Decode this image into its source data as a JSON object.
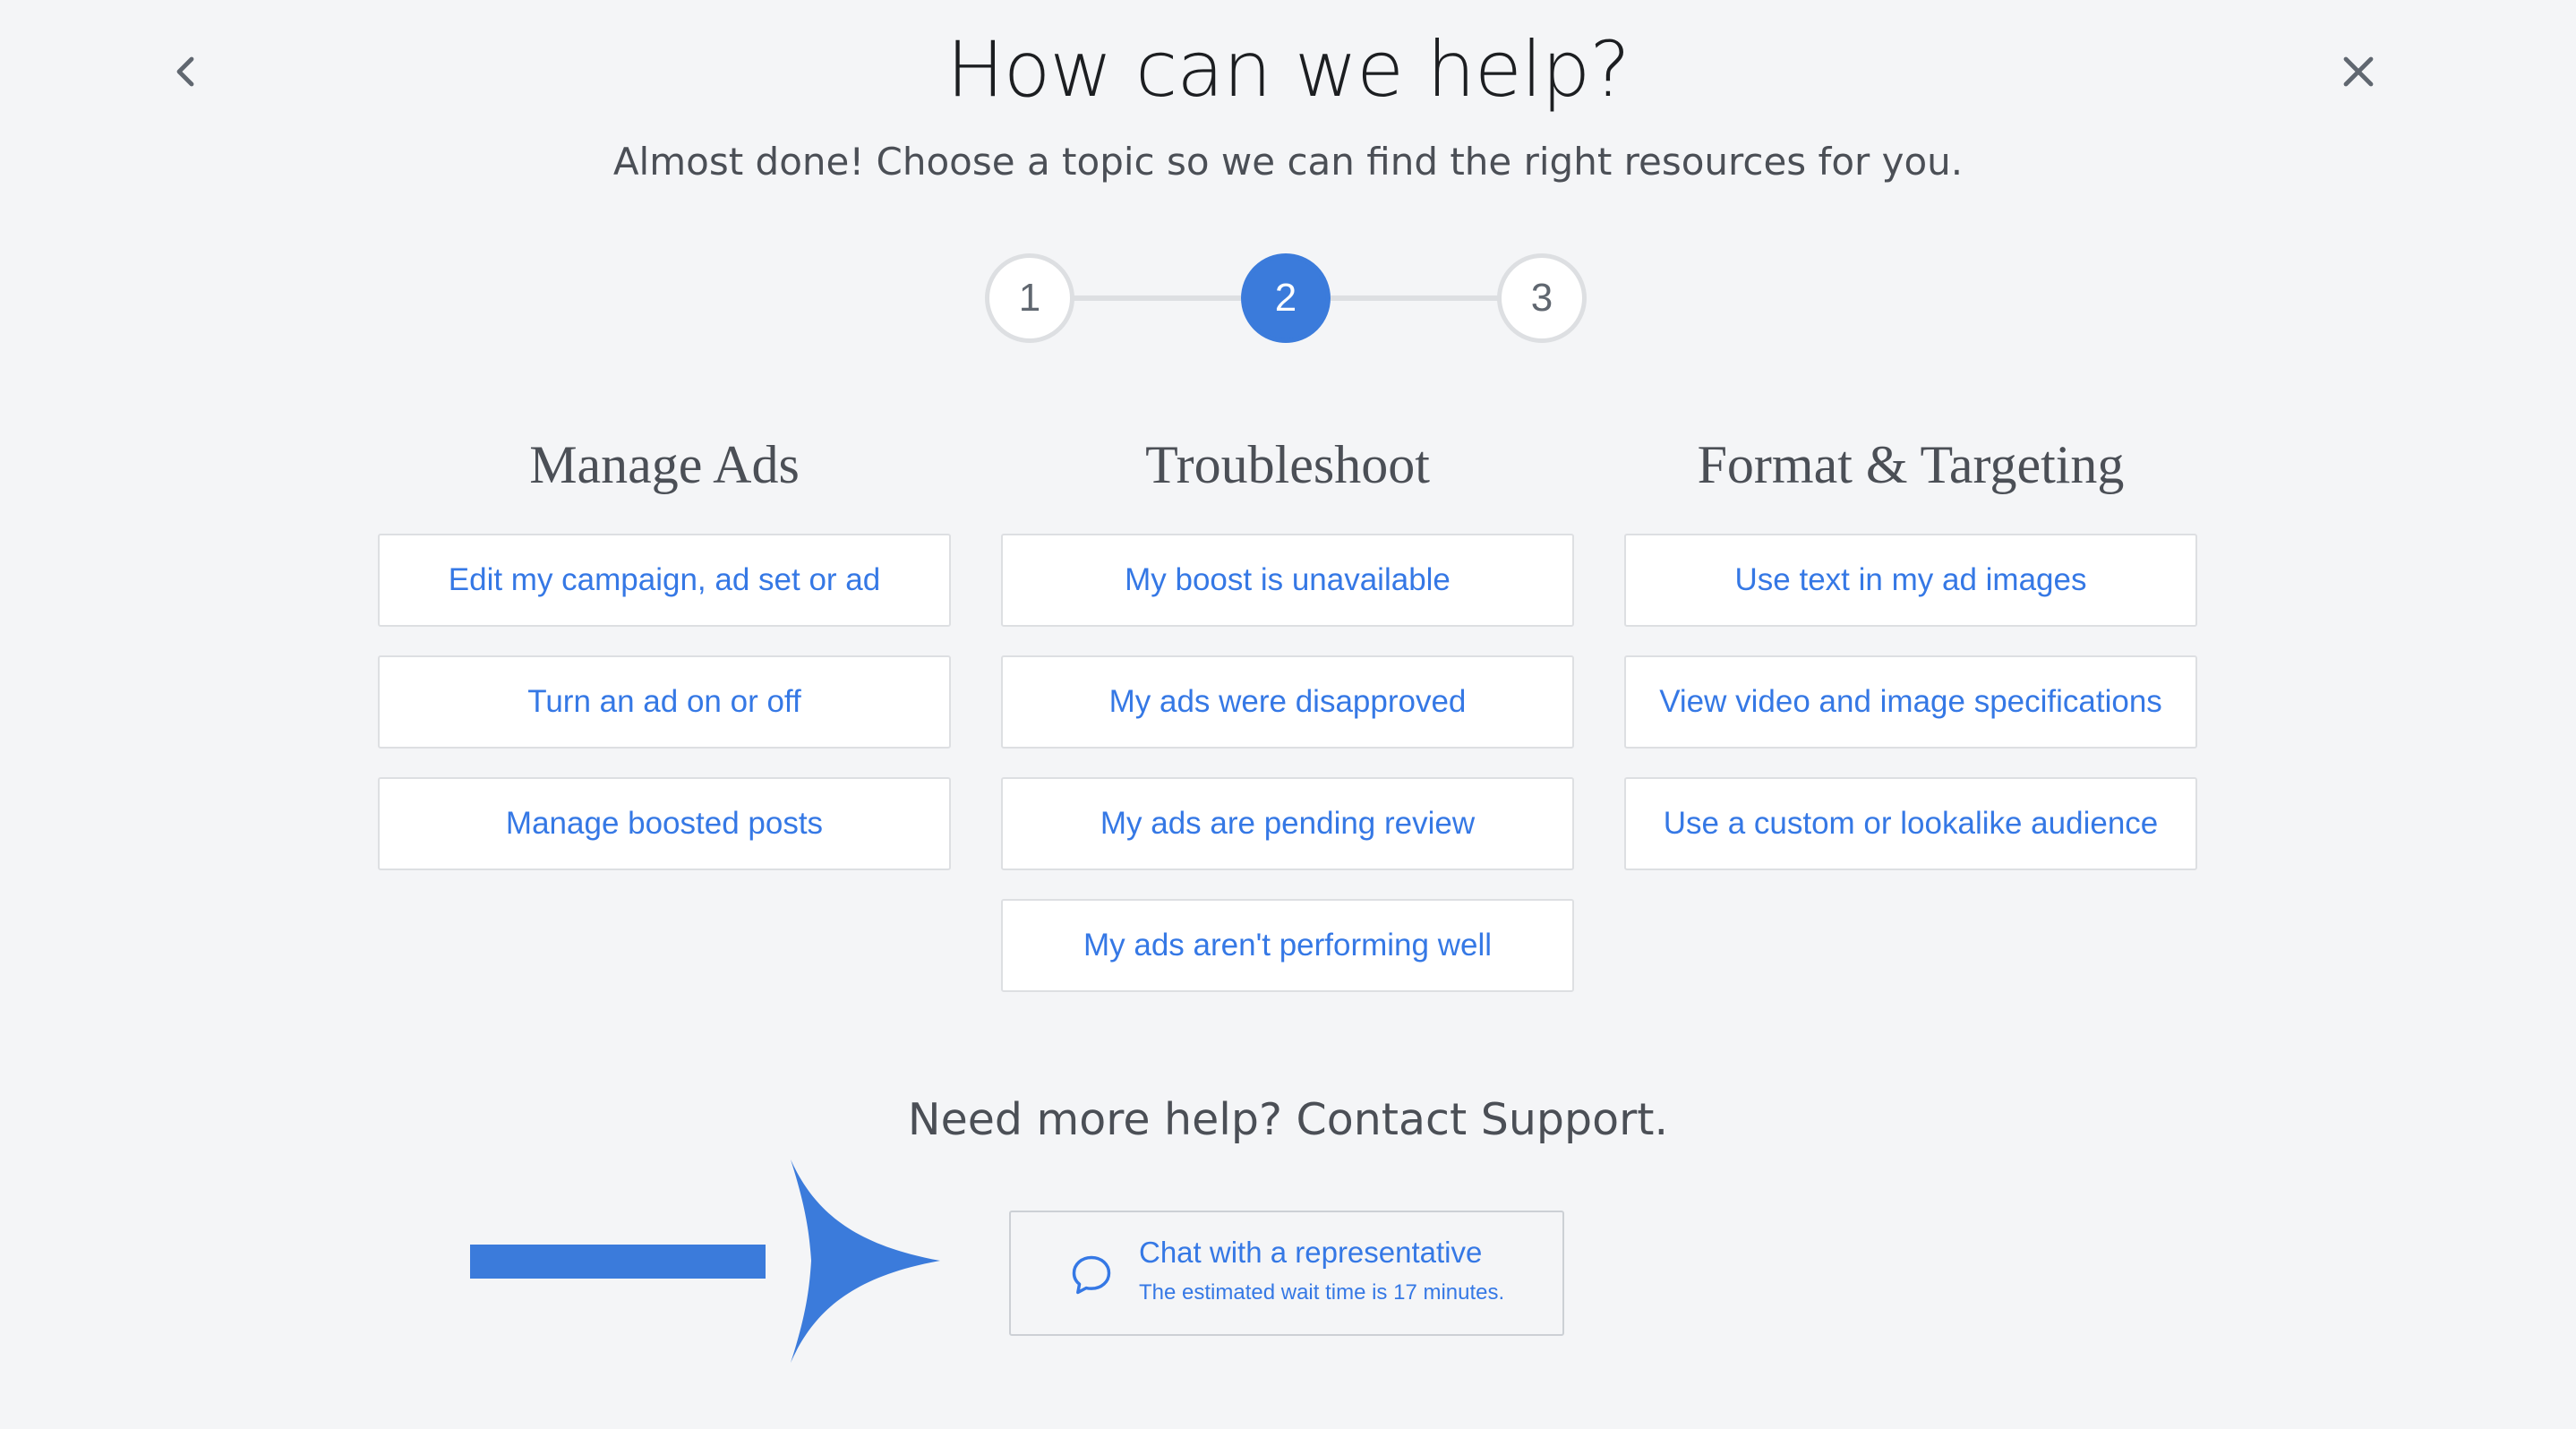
{
  "header": {
    "title": "How can we help?",
    "subtitle": "Almost done! Choose a topic so we can find the right resources for you.",
    "back_icon": "chevron-left-icon",
    "close_icon": "close-icon"
  },
  "stepper": {
    "steps": [
      "1",
      "2",
      "3"
    ],
    "active_step": "2"
  },
  "columns": [
    {
      "title": "Manage Ads",
      "options": [
        "Edit my campaign, ad set or ad",
        "Turn an ad on or off",
        "Manage boosted posts"
      ]
    },
    {
      "title": "Troubleshoot",
      "options": [
        "My boost is unavailable",
        "My ads were disapproved",
        "My ads are pending review",
        "My ads aren't performing well"
      ]
    },
    {
      "title": "Format & Targeting",
      "options": [
        "Use text in my ad images",
        "View video and image specifications",
        "Use a custom or lookalike audience"
      ]
    }
  ],
  "support": {
    "heading": "Need more help? Contact Support.",
    "chat_label": "Chat with a representative",
    "chat_sub": "The estimated wait time is 17 minutes.",
    "chat_icon": "chat-bubble-icon"
  },
  "colors": {
    "accent": "#3578e5",
    "step_active": "#3b7bdb",
    "annotation_arrow": "#3b7bdb"
  }
}
